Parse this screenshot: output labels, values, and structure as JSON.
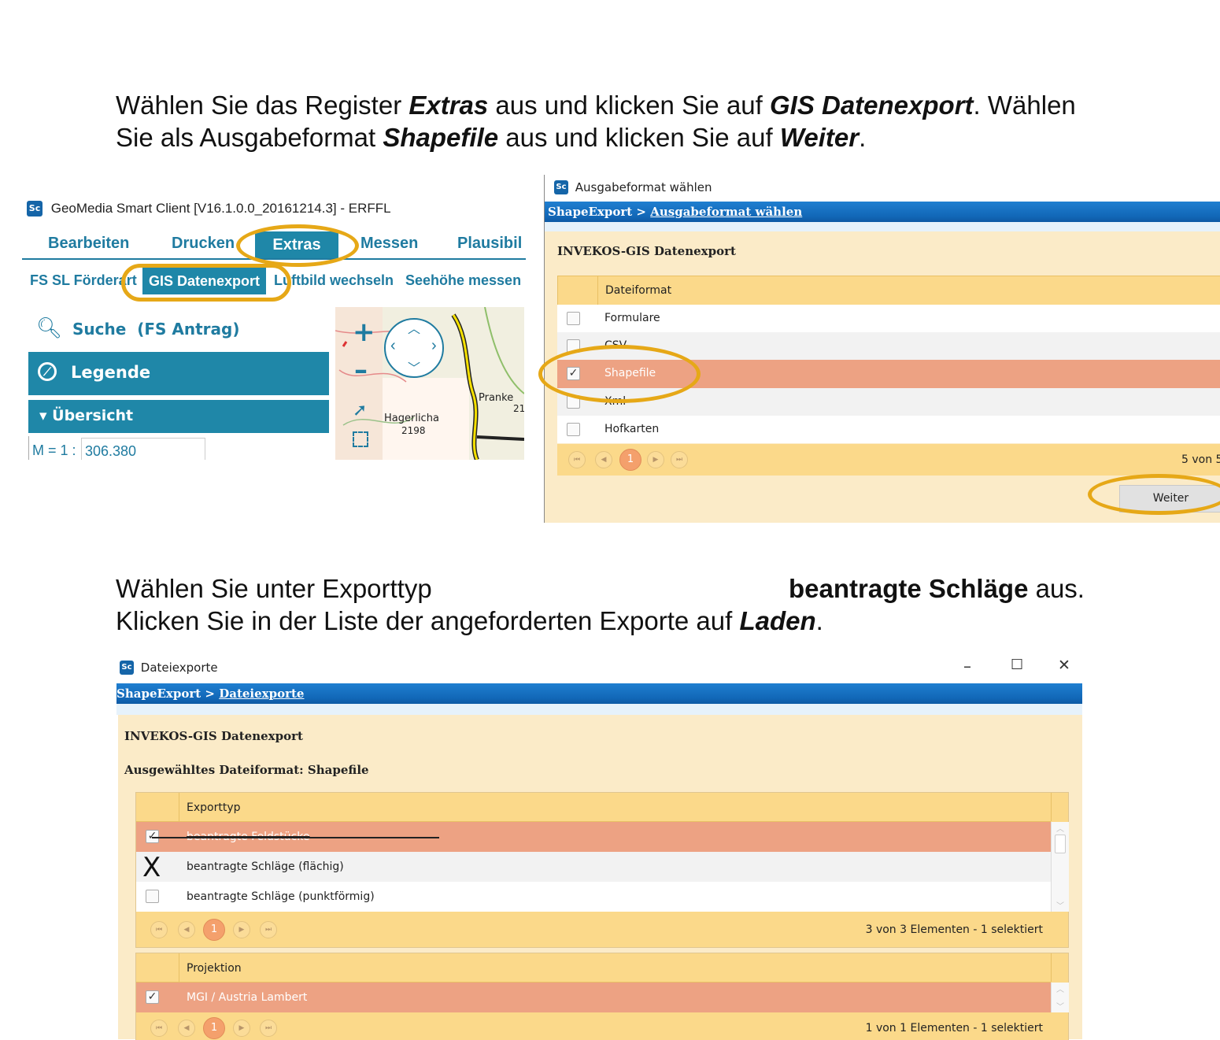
{
  "intro1": {
    "line1_a": "Wählen Sie das Register ",
    "line1_b": "Extras",
    "line1_c": " aus und klicken Sie auf ",
    "line1_d": "GIS Datenexport",
    "line1_e": ". Wählen",
    "line2_a": "Sie als Ausgabeformat ",
    "line2_b": "Shapefile",
    "line2_c": " aus und klicken Sie auf ",
    "line2_d": "Weiter",
    "line2_e": "."
  },
  "geomedia": {
    "logo": "Sc",
    "title": "GeoMedia Smart Client  [V16.1.0.0_20161214.3] - ERFFL",
    "tabs": [
      "Bearbeiten",
      "Drucken",
      "Extras",
      "Messen",
      "Plausibil"
    ],
    "subtabs": [
      "FS SL Förderart",
      "GIS Datenexport",
      "Luftbild wechseln",
      "Seehöhe messen"
    ],
    "search_label": "Suche  (FS Antrag)",
    "legend_label": "Legende",
    "overview_label": "Übersicht",
    "scale_prefix": "M = 1 :",
    "scale_value": "306.380",
    "map_label1": "Pranke",
    "map_label2": "21",
    "map_label3": "Hagerlicha",
    "map_label4": "2198"
  },
  "dialog1": {
    "logo": "Sc",
    "title": "Ausgabeformat wählen",
    "crumb_root": "ShapeExport",
    "crumb_sep": " > ",
    "crumb_current": "Ausgabeformat wählen",
    "heading": "INVEKOS-GIS Datenexport",
    "column": "Dateiformat",
    "rows": [
      "Formulare",
      "CSV",
      "Shapefile",
      "Xml",
      "Hofkarten"
    ],
    "page": "1",
    "count": "5 von 5",
    "next_button": "Weiter"
  },
  "intro2": {
    "line1_a": "Wählen Sie unter Exporttyp",
    "line1_b": "beantragte Schläge",
    "line1_c": " aus.",
    "line2_a": "Klicken Sie in der Liste der angeforderten Exporte auf ",
    "line2_b": "Laden",
    "line2_c": "."
  },
  "dialog2": {
    "logo": "Sc",
    "title": "Dateiexporte",
    "crumb_root": "ShapeExport",
    "crumb_sep": " > ",
    "crumb_current": "Dateiexporte",
    "heading": "INVEKOS-GIS Datenexport",
    "format_line": "Ausgewähltes Dateiformat: Shapefile",
    "export_column": "Exporttyp",
    "export_rows": [
      "beantragte Feldstücke",
      "beantragte Schläge (flächig)",
      "beantragte Schläge (punktförmig)"
    ],
    "x_mark": "X",
    "export_page": "1",
    "export_count": "3 von 3 Elementen - 1 selektiert",
    "proj_column": "Projektion",
    "proj_rows": [
      "MGI / Austria Lambert"
    ],
    "proj_page": "1",
    "proj_count": "1 von 1 Elementen - 1 selektiert",
    "win_min": "–",
    "win_max": "☐",
    "win_close": "✕"
  },
  "colors": {
    "accent_teal": "#1f87a8",
    "highlight_ring": "#e6a817",
    "selected_row": "#eda283",
    "panel_cream": "#fbebc8",
    "header_yellow": "#fbd98a",
    "crumb_blue": "#1268b8"
  }
}
